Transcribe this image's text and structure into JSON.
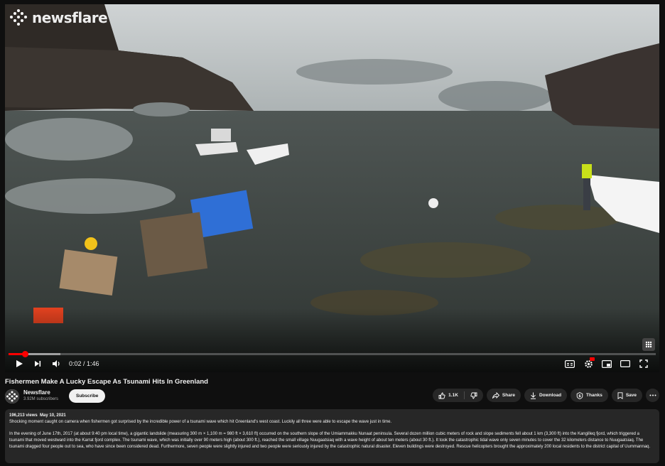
{
  "player": {
    "watermark": "newsflare",
    "time_current": "0:02",
    "time_total": "1:46",
    "time_separator": " / ",
    "progress_played": 0.025,
    "progress_buffered": 0.08
  },
  "video": {
    "title": "Fishermen Make A Lucky Escape As Tsunami Hits In Greenland"
  },
  "channel": {
    "name": "Newsflare",
    "subscribers": "3.92M subscribers",
    "subscribe_label": "Subscribe"
  },
  "actions": {
    "likes": "1.1K",
    "share": "Share",
    "download": "Download",
    "thanks": "Thanks",
    "save": "Save"
  },
  "description": {
    "views": "196,213 views",
    "date": "May 10, 2021",
    "summary": "Shocking moment caught on camera when fishermen got surprised by the incredible power of a tsunami wave which hit Greenland's west coast. Luckily all three were able to escape the wave just in time.",
    "body": "In the evening of June 17th, 2017 (at about 9:40 pm local time), a gigantic landslide (measuring 300 m × 1,100 m = 980 ft × 3,610 ft) occurred on the southern slope of the Umiammakku Nunaat peninsula. Several dozen million cubic meters of rock and slope sediments fell about 1 km (3,300 ft) into the Kangilleq fjord, which triggered a tsunami that moved westward into the Karrat fjord complex. The tsunami wave, which was initially over 90 meters high (about 300 ft.), reached the small village Nuugaatsiaq with a wave height of about ten meters (about 30 ft.). It took the catastrophic tidal wave only seven minutes to cover the 32 kilometers distance to Nuugaatsiaq. The tsunami dragged four people out to sea, who have since been considered dead. Furthermore, seven people were slightly injured and two people were seriously injured by the catastrophic natural disaster. Eleven buildings were destroyed. Rescue helicopters brought the approximately 200 local residents to the district capital of Uummannaq."
  },
  "colors": {
    "background": "#0f0f0f",
    "surface": "#272727",
    "progress": "#ff0000",
    "text": "#f1f1f1",
    "muted": "#aaaaaa"
  }
}
